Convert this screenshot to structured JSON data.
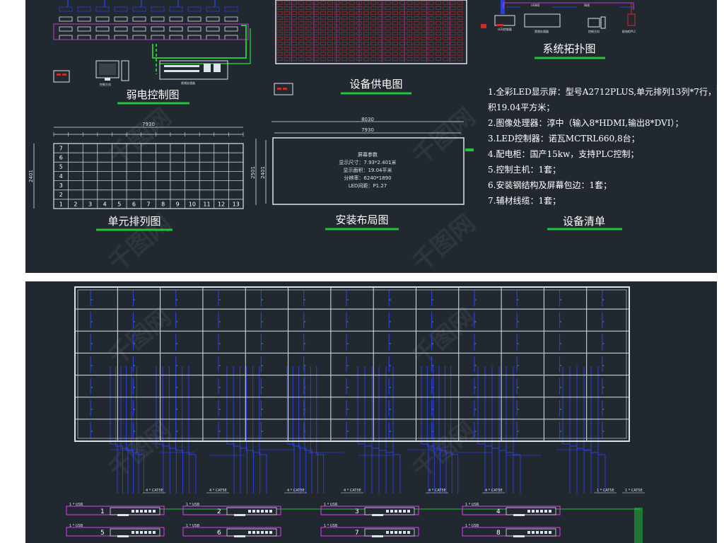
{
  "titles": {
    "weak": "弱电控制图",
    "power": "设备供电图",
    "topology": "系统拓扑图",
    "unit": "单元排列图",
    "layout": "安装布局图",
    "list": "设备清单"
  },
  "topology_labels": {
    "usb": "USB网",
    "net": "网线",
    "ctrl": "LED控制器",
    "proc": "视频处理器",
    "pc": "控制主机",
    "plc": "配电柜PLC"
  },
  "weak_labels": {
    "pc": "控制主机",
    "proc": "视频处理器"
  },
  "dimensions": {
    "unit_width": "7930",
    "unit_height": "2401",
    "layout_outer_width": "8030",
    "layout_inner_width": "7930",
    "layout_outer_height": "2501",
    "layout_inner_height": "2401"
  },
  "unit_grid": {
    "rows": [
      "7",
      "6",
      "5",
      "4",
      "3",
      "2",
      "1"
    ],
    "cols": [
      "2",
      "3",
      "4",
      "5",
      "6",
      "7",
      "8",
      "9",
      "10",
      "11",
      "12",
      "13"
    ]
  },
  "screen_params": {
    "heading": "屏幕参数",
    "size": "显示尺寸：7.93*2.401米",
    "area": "显示面积：19.04平米",
    "resolution": "分辨率：6240*1890",
    "pitch": "LED间距：P1.27"
  },
  "equipment_list": [
    "1.全彩LED显示屏：型号A2712PLUS,单元排列13列*7行，面",
    "积19.04平方米；",
    "2.图像处理器：淳中（输入8*HDMI,输出8*DVI）；",
    "3.LED控制器：诺瓦MCTRL660,8台；",
    "4.配电柜：国产15kw，支持PLC控制；",
    "5.控制主机：1套；",
    "6.安装钢结构及屏幕包边：1套；",
    "7.辅材线缆：1套；"
  ],
  "wiring": {
    "cable_labels": [
      "4 * CAT5E",
      "4 * CAT5E",
      "4 * CAT5E",
      "4 * CAT5E",
      "4 * CAT5E",
      "4 * CAT5E",
      "1 * CAT5E",
      "1 * CAT5E"
    ],
    "usb_label": "1 * USB",
    "controllers_top": [
      "1",
      "2",
      "3",
      "4"
    ],
    "controllers_bottom": [
      "5",
      "6",
      "7",
      "8"
    ]
  },
  "watermark": "千图网",
  "colors": {
    "background": "#222830",
    "line": "#dde3ea",
    "accent_green": "#22c43a",
    "magenta": "#c13ad0",
    "blue": "#2a3fd6",
    "red": "#d02b2b"
  }
}
